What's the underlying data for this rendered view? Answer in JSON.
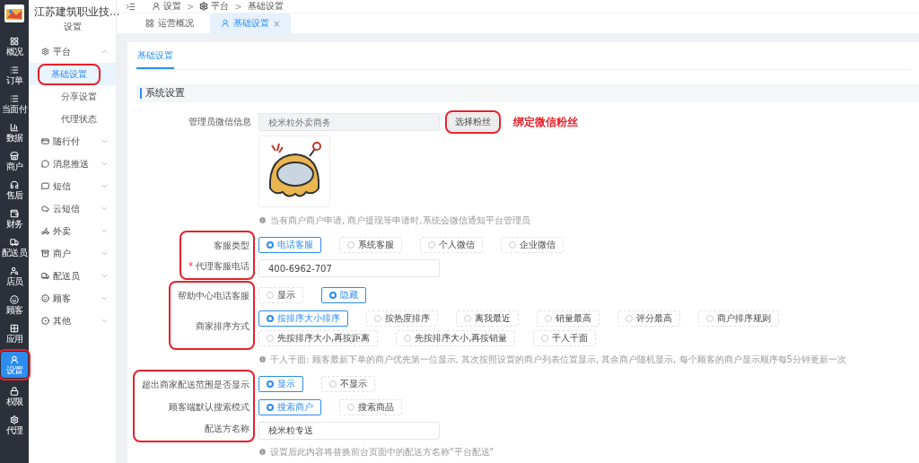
{
  "main_nav": [
    {
      "label": "概况",
      "selected": false,
      "highlighted": false
    },
    {
      "label": "订单",
      "selected": false,
      "highlighted": false
    },
    {
      "label": "当面付",
      "selected": false,
      "highlighted": false
    },
    {
      "label": "数据",
      "selected": false,
      "highlighted": false
    },
    {
      "label": "商户",
      "selected": false,
      "highlighted": false
    },
    {
      "label": "售后",
      "selected": false,
      "highlighted": false
    },
    {
      "label": "财务",
      "selected": false,
      "highlighted": false
    },
    {
      "label": "配送员",
      "selected": false,
      "highlighted": false
    },
    {
      "label": "店员",
      "selected": false,
      "highlighted": false
    },
    {
      "label": "顾客",
      "selected": false,
      "highlighted": false
    },
    {
      "label": "应用",
      "selected": false,
      "highlighted": false
    },
    {
      "label": "设置",
      "selected": true,
      "highlighted": true
    },
    {
      "label": "权限",
      "selected": false,
      "highlighted": false
    },
    {
      "label": "代理",
      "selected": false,
      "highlighted": false
    }
  ],
  "sub_nav": {
    "title": "江苏建筑职业技...",
    "subtitle": "设置",
    "groups": [
      {
        "label": "平台",
        "expanded": true,
        "children": [
          {
            "label": "基础设置",
            "selected": true,
            "highlighted": true
          },
          {
            "label": "分享设置",
            "selected": false,
            "highlighted": false
          },
          {
            "label": "代理状态",
            "selected": false,
            "highlighted": false
          }
        ]
      },
      {
        "label": "随行付",
        "expanded": false
      },
      {
        "label": "消息推送",
        "expanded": false
      },
      {
        "label": "短信",
        "expanded": false
      },
      {
        "label": "云短信",
        "expanded": false
      },
      {
        "label": "外卖",
        "expanded": false
      },
      {
        "label": "商户",
        "expanded": false
      },
      {
        "label": "配送员",
        "expanded": false
      },
      {
        "label": "顾客",
        "expanded": false
      },
      {
        "label": "其他",
        "expanded": false
      }
    ]
  },
  "breadcrumb": [
    "设置",
    "平台",
    "基础设置"
  ],
  "breadcrumb_separator": ">",
  "page_tabs": [
    {
      "label": "运营概况",
      "selected": false
    },
    {
      "label": "基础设置",
      "selected": true,
      "close": "×"
    }
  ],
  "inner_tabs": [
    {
      "label": "基础设置",
      "selected": true
    }
  ],
  "section_title": "系统设置",
  "form": [
    {
      "kind": "fan_select",
      "label": "管理员微信信息",
      "placeholder": "校米粒外卖商务",
      "button": "选择粉丝",
      "button_highlighted": true,
      "note": "绑定微信粉丝"
    },
    {
      "kind": "avatar"
    },
    {
      "kind": "hint",
      "text": "当有商户商户申请, 商户提现等申请时,系统会微信通知平台管理员"
    },
    {
      "kind": "group",
      "highlighted": true,
      "rows": [
        {
          "kind": "radio",
          "label": "客服类型",
          "options": [
            {
              "label": "电话客服",
              "selected": true
            },
            {
              "label": "系统客服",
              "selected": false
            },
            {
              "label": "个人微信",
              "selected": false
            },
            {
              "label": "企业微信",
              "selected": false
            }
          ]
        },
        {
          "kind": "input",
          "label": "代理客服电话",
          "required_mark": "*",
          "value": "400-6962-707"
        }
      ]
    },
    {
      "kind": "group",
      "highlighted": true,
      "rows": [
        {
          "kind": "radio",
          "label": "帮助中心电话客服",
          "options": [
            {
              "label": "显示",
              "selected": false
            },
            {
              "label": "隐藏",
              "selected": true
            }
          ]
        },
        {
          "kind": "radio",
          "label": "商家排序方式",
          "options": [
            {
              "label": "按排序大小排序",
              "selected": true
            },
            {
              "label": "按热度排序",
              "selected": false
            },
            {
              "label": "离我最近",
              "selected": false
            },
            {
              "label": "销量最高",
              "selected": false
            },
            {
              "label": "评分最高",
              "selected": false
            },
            {
              "label": "商户排序规则",
              "selected": false
            },
            {
              "label": "先按排序大小,再按距离",
              "selected": false
            },
            {
              "label": "先按排序大小,再按销量",
              "selected": false
            },
            {
              "label": "千人千面",
              "selected": false
            }
          ]
        }
      ]
    },
    {
      "kind": "hint",
      "text": "千人千面: 顾客最新下单的商户优先第一位显示, 其次按照设置的商户列表位置显示, 其余商户随机显示, 每个顾客的商户显示顺序每5分钟更新一次"
    },
    {
      "kind": "group",
      "highlighted": true,
      "rows": [
        {
          "kind": "radio",
          "label": "超出商家配送范围是否显示",
          "options": [
            {
              "label": "显示",
              "selected": true
            },
            {
              "label": "不显示",
              "selected": false
            }
          ]
        },
        {
          "kind": "radio",
          "label": "顾客端默认搜索模式",
          "options": [
            {
              "label": "搜索商户",
              "selected": true
            },
            {
              "label": "搜索商品",
              "selected": false
            }
          ]
        },
        {
          "kind": "input",
          "label": "配送方名称",
          "value": "校米粒专送"
        }
      ]
    },
    {
      "kind": "hint",
      "text": "设置后此内容将替换前台页面中的配送方名称\"平台配送\""
    }
  ]
}
